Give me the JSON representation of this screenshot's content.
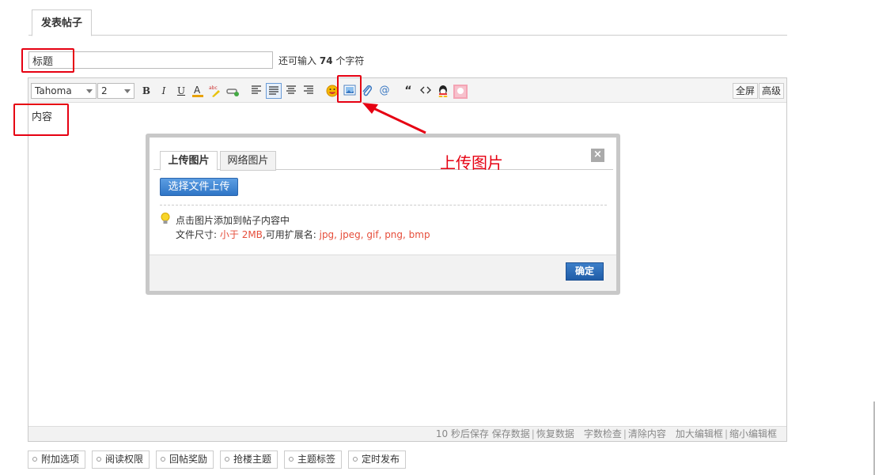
{
  "tab": {
    "label": "发表帖子"
  },
  "title_input": {
    "value": "标题"
  },
  "chars_left": {
    "prefix": "还可输入",
    "count": "74",
    "suffix": "个字符"
  },
  "toolbar": {
    "font_family": "Tahoma",
    "font_size": "2",
    "bold": "B",
    "italic": "I",
    "underline": "U",
    "fullscreen": "全屏",
    "advanced": "高级"
  },
  "editor": {
    "content_label": "内容"
  },
  "statusbar": {
    "autosave": "10 秒后保存",
    "save": "保存数据",
    "restore": "恢复数据",
    "check": "字数检查",
    "clear": "清除内容",
    "enlarge": "加大编辑框",
    "shrink": "缩小编辑框"
  },
  "dialog": {
    "tabs": [
      "上传图片",
      "网络图片"
    ],
    "close": "×",
    "upload_button": "选择文件上传",
    "hint": "点击图片添加到帖子内容中",
    "filesize_label": "文件尺寸:",
    "filesize_value": "小于 2MB",
    "ext_label": ",可用扩展名:",
    "ext_value": "jpg, jpeg, gif, png, bmp",
    "ok_button": "确定"
  },
  "annotation": {
    "text": "上传图片",
    "color": "#e60012"
  },
  "options": [
    "附加选项",
    "阅读权限",
    "回帖奖励",
    "抢楼主题",
    "主题标签",
    "定时发布"
  ]
}
